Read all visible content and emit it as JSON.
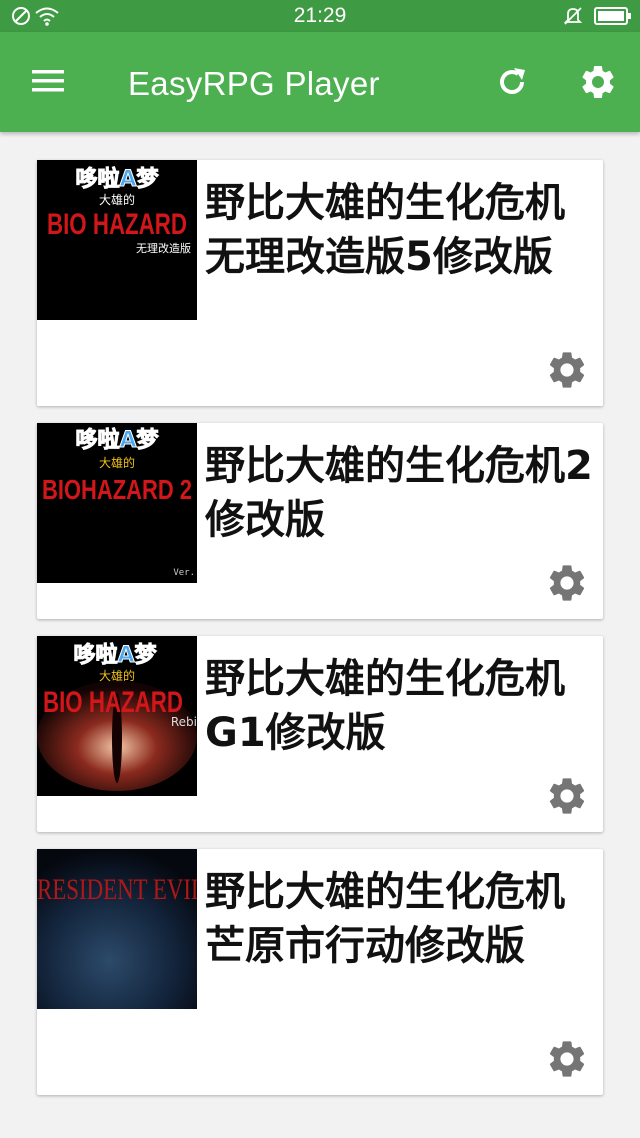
{
  "status_bar": {
    "time": "21:29"
  },
  "app_bar": {
    "title": "EasyRPG Player",
    "menu_icon": "menu-icon",
    "refresh_icon": "refresh-icon",
    "settings_icon": "settings-gear-icon"
  },
  "colors": {
    "status_bar": "#3f9b43",
    "app_bar": "#4caf50",
    "background": "#f2f2f2",
    "card": "#ffffff",
    "gear": "#757575"
  },
  "games": [
    {
      "title": "野比大雄的生化危机无理改造版5修改版",
      "thumb": {
        "top_text": "哆啦A梦",
        "sub_text": "大雄的",
        "main_text": "BIO HAZARD",
        "caption": "无理改造版"
      }
    },
    {
      "title": "野比大雄的生化危机2修改版",
      "thumb": {
        "top_text": "哆啦A梦",
        "sub_text": "大雄的",
        "main_text": "BIOHAZARD 2",
        "caption": "Ver."
      }
    },
    {
      "title": "野比大雄的生化危机G1修改版",
      "thumb": {
        "top_text": "哆啦A梦",
        "sub_text": "大雄的",
        "main_text": "BIO HAZARD",
        "caption": "Rebi"
      }
    },
    {
      "title": "野比大雄的生化危机芒原市行动修改版",
      "thumb": {
        "top_text": "",
        "sub_text": "",
        "main_text": "RESIDENT EVIL",
        "caption": ""
      }
    }
  ]
}
